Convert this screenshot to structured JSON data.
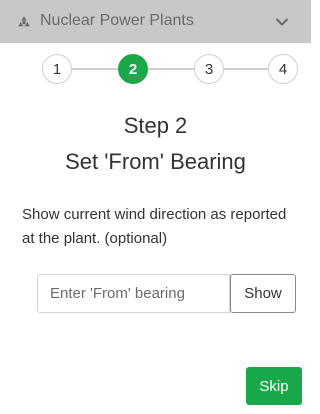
{
  "header": {
    "icon": "nuclear-icon",
    "title": "Nuclear Power Plants",
    "collapse_icon": "chevron-down-icon"
  },
  "stepper": {
    "steps": [
      "1",
      "2",
      "3",
      "4"
    ],
    "active_step": 2,
    "active_color": "#1aa84a"
  },
  "content": {
    "step_heading": "Step 2",
    "step_title": "Set 'From' Bearing",
    "description": "Show current wind direction as reported at the plant. (optional)"
  },
  "form": {
    "bearing_placeholder": "Enter 'From' bearing",
    "bearing_value": "",
    "show_label": "Show"
  },
  "footer": {
    "skip_label": "Skip"
  },
  "colors": {
    "header_bg": "#c8c8c8",
    "accent": "#1aa84a"
  }
}
